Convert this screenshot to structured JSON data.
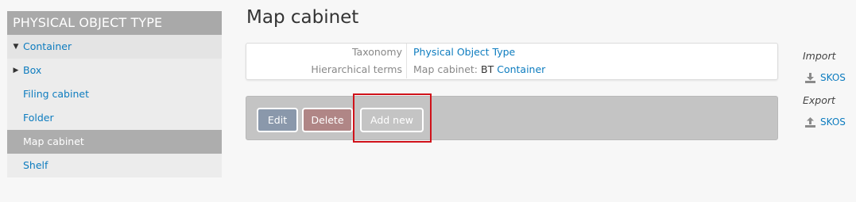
{
  "sidebar": {
    "title": "PHYSICAL OBJECT TYPE",
    "items": [
      {
        "label": "Container",
        "toggle": "▼"
      },
      {
        "label": "Box",
        "toggle": "▶"
      },
      {
        "label": "Filing cabinet"
      },
      {
        "label": "Folder"
      },
      {
        "label": "Map cabinet",
        "active": true
      },
      {
        "label": "Shelf"
      }
    ]
  },
  "main": {
    "title": "Map cabinet",
    "info": {
      "taxonomy_label": "Taxonomy",
      "taxonomy_value": "Physical Object Type",
      "hier_label": "Hierarchical terms",
      "hier_prefix": "Map cabinet:",
      "hier_bt": "BT",
      "hier_link": "Container"
    },
    "actions": {
      "edit": "Edit",
      "delete": "Delete",
      "add_new": "Add new"
    }
  },
  "right": {
    "import_label": "Import",
    "import_link": "SKOS",
    "export_label": "Export",
    "export_link": "SKOS"
  },
  "colors": {
    "link": "#0d7cbf",
    "highlight": "#d0121a",
    "edit_button": "#8a98ab",
    "delete_button": "#b08686"
  },
  "icons": {
    "import": "download-icon",
    "export": "upload-icon"
  }
}
